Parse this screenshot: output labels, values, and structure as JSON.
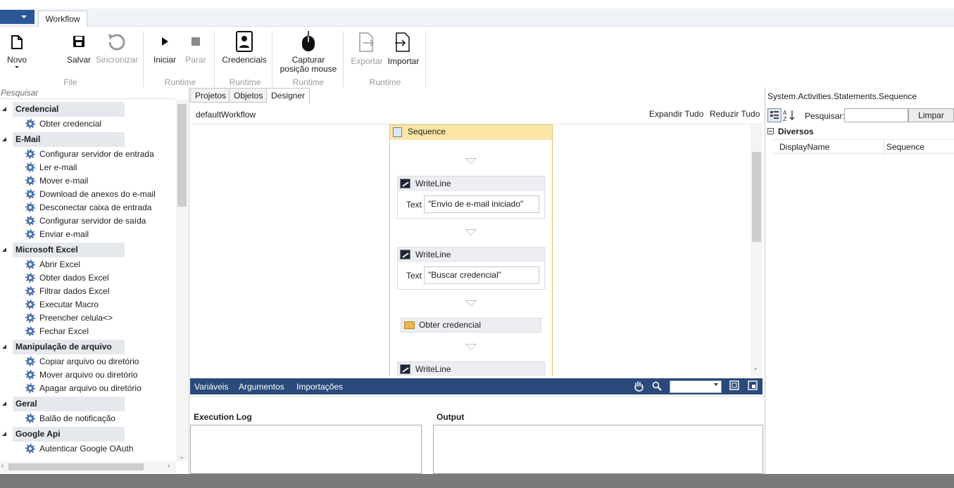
{
  "ribbon": {
    "tab": "Workflow",
    "buttons": {
      "novo": "Novo",
      "salvar": "Salvar",
      "sincronizar": "Sincronizar",
      "iniciar": "Iniciar",
      "parar": "Parar",
      "credenciais": "Credenciais",
      "capturar_line1": "Capturar",
      "capturar_line2": "posição mouse",
      "exportar": "Exportar",
      "importar": "Importar"
    },
    "groups": {
      "file": "File",
      "runtime1": "Runtime",
      "runtime2": "Runtime",
      "runtime3": "Runtime",
      "runtime4": "Runtime"
    }
  },
  "toolbox": {
    "search_placeholder": "Pesquisar",
    "categories": [
      {
        "name": "Credencial",
        "items": [
          "Obter credencial"
        ]
      },
      {
        "name": "E-Mail",
        "items": [
          "Configurar servidor de entrada",
          "Ler e-mail",
          "Mover e-mail",
          "Download de anexos do e-mail",
          "Desconectar caixa de entrada",
          "Configurar servidor de saída",
          "Enviar e-mail"
        ]
      },
      {
        "name": "Microsoft Excel",
        "items": [
          "Abrir Excel",
          "Obter dados Excel",
          "Filtrar dados Excel",
          "Executar Macro",
          "Preencher celula<>",
          "Fechar Excel"
        ]
      },
      {
        "name": "Manipulação de arquivo",
        "items": [
          "Copiar arquivo ou diretório",
          "Mover arquivo ou diretório",
          "Apagar arquivo ou diretório"
        ]
      },
      {
        "name": "Geral",
        "items": [
          "Balão de notificação"
        ]
      },
      {
        "name": "Google Api",
        "items": [
          "Autenticar Google OAuth"
        ]
      }
    ]
  },
  "designer": {
    "tabs": [
      "Projetos",
      "Objetos",
      "Designer"
    ],
    "breadcrumb": "defaultWorkflow",
    "expand_all": "Expandir Tudo",
    "collapse_all": "Reduzir Tudo",
    "sequence_title": "Sequence",
    "activities": [
      {
        "title": "WriteLine",
        "field_label": "Text",
        "field_value": "\"Envio de e-mail iniciado\""
      },
      {
        "title": "WriteLine",
        "field_label": "Text",
        "field_value": "\"Buscar credencial\""
      },
      {
        "title": "Obter credencial"
      },
      {
        "title": "WriteLine"
      }
    ],
    "bottom_bar": {
      "variables": "Variáveis",
      "arguments": "Argumentos",
      "imports": "Importações"
    }
  },
  "logs": {
    "execution_log": "Execution Log",
    "output": "Output"
  },
  "properties": {
    "title": "System.Activities.Statements.Sequence",
    "search_label": "Pesquisar:",
    "clear_button": "Limpar",
    "category": "Diversos",
    "rows": [
      {
        "key": "DisplayName",
        "value": "Sequence"
      }
    ]
  }
}
